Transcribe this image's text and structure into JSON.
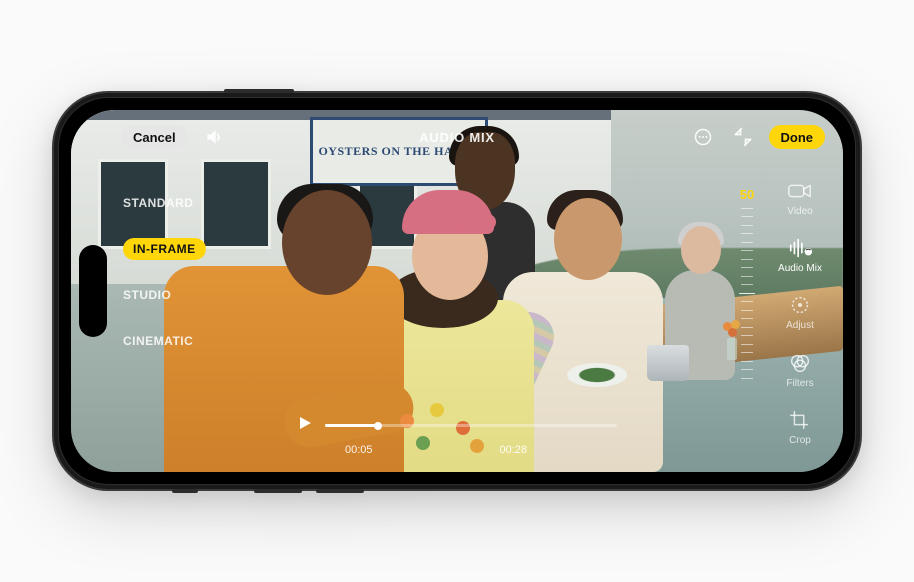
{
  "topbar": {
    "cancel": "Cancel",
    "title": "AUDIO MIX",
    "done": "Done"
  },
  "scene": {
    "sign_text": "OYSTERS ON THE HALF S"
  },
  "modes": {
    "items": [
      {
        "label": "STANDARD",
        "active": false
      },
      {
        "label": "IN-FRAME",
        "active": true
      },
      {
        "label": "STUDIO",
        "active": false
      },
      {
        "label": "CINEMATIC",
        "active": false
      }
    ]
  },
  "dial": {
    "value": "50"
  },
  "rail": {
    "items": [
      {
        "label": "Video",
        "icon": "video-icon",
        "active": false
      },
      {
        "label": "Audio Mix",
        "icon": "audiomix-icon",
        "active": true
      },
      {
        "label": "Adjust",
        "icon": "adjust-icon",
        "active": false
      },
      {
        "label": "Filters",
        "icon": "filters-icon",
        "active": false
      },
      {
        "label": "Crop",
        "icon": "crop-icon",
        "active": false
      }
    ]
  },
  "playback": {
    "elapsed": "00:05",
    "total": "00:28",
    "progress_pct": 18
  },
  "colors": {
    "accent_yellow": "#ffd60a"
  }
}
